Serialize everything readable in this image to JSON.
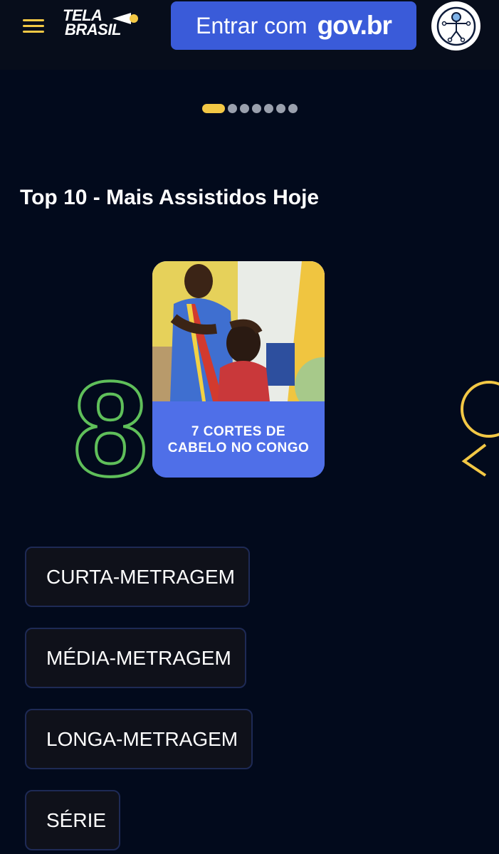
{
  "header": {
    "menu_icon": "hamburger-menu-icon",
    "logo": {
      "line1": "TELA",
      "line2": "BRASIL"
    },
    "login_button": {
      "label": "Entrar com",
      "brand": "gov.br"
    },
    "accessibility_icon": "accessibility-person-icon",
    "colors": {
      "accent": "#f3c845",
      "login_bg": "#3a5bd9",
      "header_bg": "#070d1b"
    }
  },
  "carousel": {
    "dot_count": 7,
    "active_index": 0
  },
  "top10": {
    "title": "Top 10 - Mais Assistidos Hoje",
    "items": [
      {
        "rank": "8",
        "title": "7 CORTES DE CABELO NO CONGO",
        "rank_color": "#5fbf5a"
      }
    ],
    "next_rank_color": "#f3c845"
  },
  "categories": [
    {
      "label": "CURTA-METRAGEM"
    },
    {
      "label": "MÉDIA-METRAGEM"
    },
    {
      "label": "LONGA-METRAGEM"
    },
    {
      "label": "SÉRIE"
    }
  ],
  "colors": {
    "page_bg": "#020a1c",
    "card_banner": "#4f6fe8",
    "button_border": "#1e2a55"
  }
}
